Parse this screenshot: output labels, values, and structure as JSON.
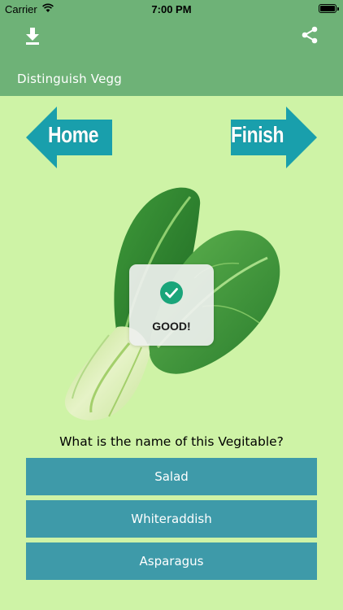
{
  "status_bar": {
    "carrier": "Carrier",
    "time": "7:00 PM"
  },
  "nav": {
    "title": "Distinguish Vegg",
    "left_icon": "download-icon",
    "right_icon": "share-icon"
  },
  "arrows": {
    "home_label": "Home",
    "finish_label": "Finish",
    "color": "#199fac"
  },
  "toast": {
    "icon": "check-circle-icon",
    "message": "GOOD!"
  },
  "question": "What is the name of this Vegitable?",
  "answers": [
    {
      "label": "Salad"
    },
    {
      "label": "Whiteraddish"
    },
    {
      "label": "Asparagus"
    }
  ],
  "colors": {
    "background": "#cef3a6",
    "nav": "#6eb277",
    "answer_button": "#3e9aa9",
    "check": "#1aa57a"
  }
}
